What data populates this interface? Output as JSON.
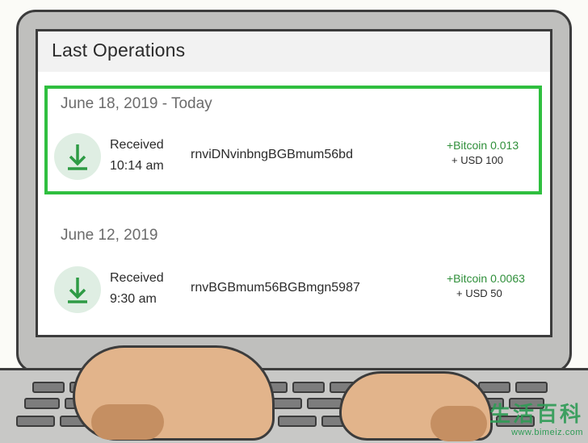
{
  "screen": {
    "title": "Last Operations",
    "groups": [
      {
        "date": "June 18, 2019 - Today",
        "highlighted": true,
        "transaction": {
          "status": "Received",
          "time": "10:14 am",
          "txid": "rnviDNvinbngBGBmum56bd",
          "btc": "+Bitcoin 0.013",
          "usd": "+ USD  100",
          "icon": "download-arrow-icon"
        }
      },
      {
        "date": "June 12, 2019",
        "highlighted": false,
        "transaction": {
          "status": "Received",
          "time": "9:30 am",
          "txid": "rnvBGBmum56BGBmgn5987",
          "btc": "+Bitcoin 0.0063",
          "usd": "+ USD  50",
          "icon": "download-arrow-icon"
        }
      }
    ]
  },
  "watermark": {
    "chinese": "生活百科",
    "url": "www.bimeiz.com"
  },
  "colors": {
    "highlight_border": "#2fbf3f",
    "arrow_green": "#2e9b45",
    "btc_green": "#2f8f3a",
    "icon_circle": "#dfeee3"
  }
}
